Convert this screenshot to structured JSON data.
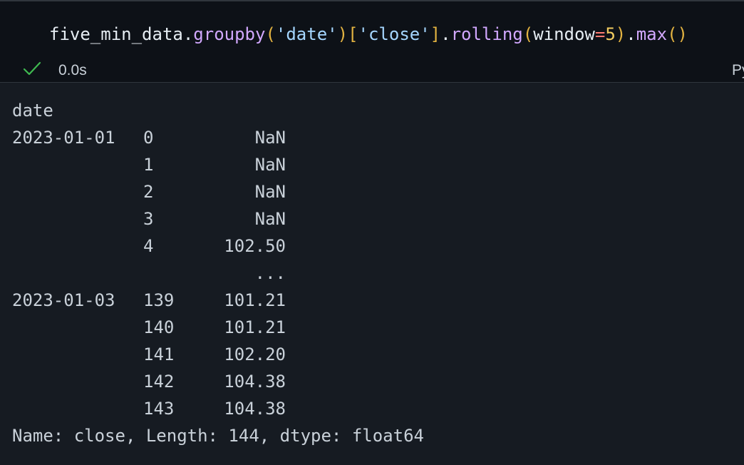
{
  "code": {
    "var": "five_min_data",
    "dot1": ".",
    "fn1": "groupby",
    "paren1_open": "(",
    "arg1": "'date'",
    "paren1_close": ")",
    "bracket_open": "[",
    "arg2": "'close'",
    "bracket_close": "]",
    "dot2": ".",
    "fn2": "rolling",
    "paren2_open": "(",
    "kw": "window",
    "eq": "=",
    "num": "5",
    "paren2_close": ")",
    "dot3": ".",
    "fn3": "max",
    "paren3": "()"
  },
  "status": {
    "check": "✓",
    "time": "0.0s",
    "kernel": "Py"
  },
  "output": {
    "header": "date",
    "rows": [
      {
        "date": "2023-01-01",
        "idx": "0",
        "val": "NaN"
      },
      {
        "date": "",
        "idx": "1",
        "val": "NaN"
      },
      {
        "date": "",
        "idx": "2",
        "val": "NaN"
      },
      {
        "date": "",
        "idx": "3",
        "val": "NaN"
      },
      {
        "date": "",
        "idx": "4",
        "val": "102.50"
      },
      {
        "date": "",
        "idx": "",
        "val": "..."
      },
      {
        "date": "2023-01-03",
        "idx": "139",
        "val": "101.21"
      },
      {
        "date": "",
        "idx": "140",
        "val": "101.21"
      },
      {
        "date": "",
        "idx": "141",
        "val": "102.20"
      },
      {
        "date": "",
        "idx": "142",
        "val": "104.38"
      },
      {
        "date": "",
        "idx": "143",
        "val": "104.38"
      }
    ],
    "footer": "Name: close, Length: 144, dtype: float64"
  }
}
